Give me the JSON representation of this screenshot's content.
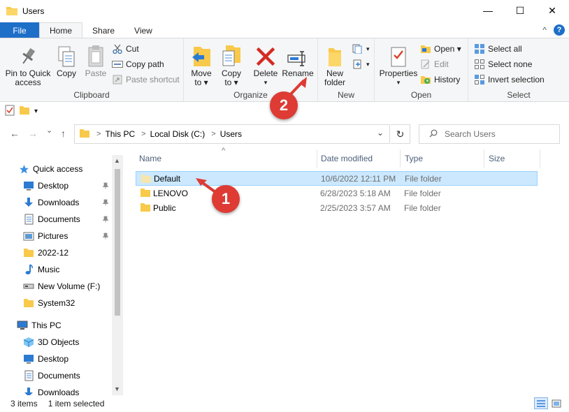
{
  "window": {
    "title": "Users",
    "minimize_glyph": "—",
    "maximize_glyph": "☐",
    "close_glyph": "✕",
    "help_glyph": "?",
    "collapse_glyph": "^"
  },
  "ribbon_tabs": [
    {
      "label": "File"
    },
    {
      "label": "Home"
    },
    {
      "label": "Share"
    },
    {
      "label": "View"
    }
  ],
  "clipboard": {
    "pin_label_1": "Pin to Quick",
    "pin_label_2": "access",
    "copy_label": "Copy",
    "paste_label": "Paste",
    "cut_label": "Cut",
    "copy_path_label": "Copy path",
    "paste_shortcut_label": "Paste shortcut",
    "group_label": "Clipboard"
  },
  "organize": {
    "move_label_1": "Move",
    "move_label_2": "to ▾",
    "copy_label_1": "Copy",
    "copy_label_2": "to ▾",
    "delete_label": "Delete",
    "delete_dropdown": "▾",
    "rename_label": "Rename",
    "group_label": "Organize"
  },
  "new_group": {
    "new_folder_label_1": "New",
    "new_folder_label_2": "folder",
    "group_label": "New"
  },
  "open_group": {
    "properties_label": "Properties",
    "properties_dropdown": "▾",
    "open_label": "Open ▾",
    "edit_label": "Edit",
    "history_label": "History",
    "group_label": "Open"
  },
  "select_group": {
    "select_all_label": "Select all",
    "select_none_label": "Select none",
    "invert_label": "Invert selection",
    "group_label": "Select"
  },
  "quick_access_toolbar": {
    "dropdown_glyph": "▾"
  },
  "address": {
    "back_glyph": "←",
    "forward_glyph": "→",
    "recent_glyph": "⌄",
    "up_glyph": "↑",
    "crumbs": [
      {
        "label": "This PC"
      },
      {
        "label": "Local Disk (C:)"
      },
      {
        "label": "Users"
      }
    ],
    "separator": ">",
    "dropdown_glyph": "⌄",
    "refresh_glyph": "↻",
    "search_placeholder": "Search Users"
  },
  "nav_pane": {
    "items": [
      {
        "label": "Quick access",
        "icon": "star-icon"
      },
      {
        "label": "Desktop",
        "icon": "desktop-icon",
        "pinned": true
      },
      {
        "label": "Downloads",
        "icon": "download-icon",
        "pinned": true
      },
      {
        "label": "Documents",
        "icon": "documents-icon",
        "pinned": true
      },
      {
        "label": "Pictures",
        "icon": "pictures-icon",
        "pinned": true
      },
      {
        "label": "2022-12",
        "icon": "folder-icon"
      },
      {
        "label": "Music",
        "icon": "music-icon"
      },
      {
        "label": "New Volume (F:)",
        "icon": "drive-icon"
      },
      {
        "label": "System32",
        "icon": "folder-icon"
      },
      {
        "label": "This PC",
        "icon": "computer-icon"
      },
      {
        "label": "3D Objects",
        "icon": "cube-icon"
      },
      {
        "label": "Desktop",
        "icon": "desktop-icon"
      },
      {
        "label": "Documents",
        "icon": "documents-icon"
      },
      {
        "label": "Downloads",
        "icon": "download-icon"
      }
    ],
    "scroll_up": "▲",
    "scroll_down": "▼"
  },
  "file_list": {
    "columns": [
      {
        "label": "Name"
      },
      {
        "label": "Date modified"
      },
      {
        "label": "Type"
      },
      {
        "label": "Size"
      }
    ],
    "sort_glyph": "^",
    "rows": [
      {
        "name": "Default",
        "date": "10/6/2022 12:11 PM",
        "type": "File folder",
        "selected": true
      },
      {
        "name": "LENOVO",
        "date": "6/28/2023 5:18 AM",
        "type": "File folder",
        "selected": false
      },
      {
        "name": "Public",
        "date": "2/25/2023 3:57 AM",
        "type": "File folder",
        "selected": false
      }
    ]
  },
  "status_bar": {
    "item_count": "3 items",
    "selection": "1 item selected"
  },
  "annotations": {
    "badge_1": "1",
    "badge_2": "2",
    "color": "#dd3b34"
  },
  "colors": {
    "file_tab": "#1e6fc8",
    "selection_bg": "#cce8ff",
    "selection_border": "#99d1ff",
    "folder_yellow": "#f8c94a"
  }
}
